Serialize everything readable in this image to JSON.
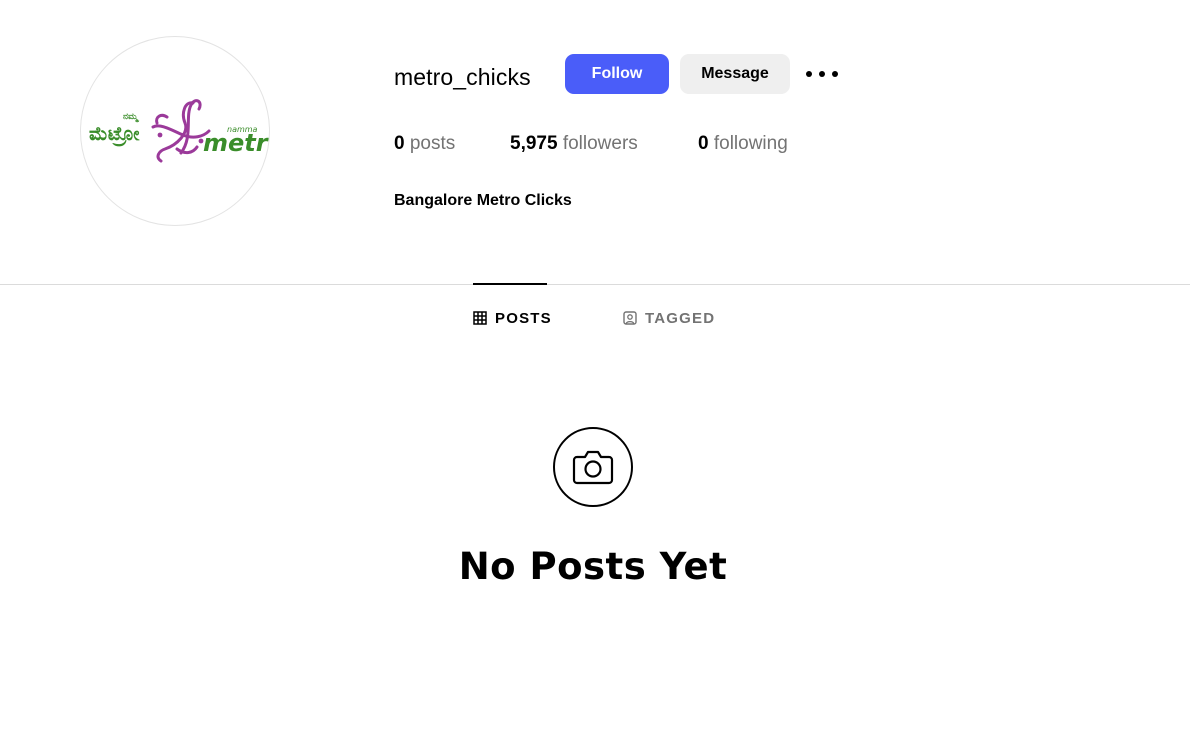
{
  "profile": {
    "username": "metro_chicks",
    "bio_name": "Bangalore Metro Clicks",
    "avatar_logo": {
      "kannada_small": "ನಮ್ಮ",
      "kannada_big": "ಮೆಟ್ರೋ",
      "english_small": "namma",
      "english_big": "metro",
      "green": "#3a8d2a",
      "purple": "#9b3a9a"
    }
  },
  "actions": {
    "follow_label": "Follow",
    "message_label": "Message",
    "more_icon": "more-horizontal-icon"
  },
  "stats": {
    "posts_count": "0",
    "posts_label": "posts",
    "followers_count": "5,975",
    "followers_label": "followers",
    "following_count": "0",
    "following_label": "following"
  },
  "tabs": [
    {
      "label": "POSTS",
      "icon": "grid-icon",
      "active": true
    },
    {
      "label": "TAGGED",
      "icon": "tagged-person-icon",
      "active": false
    }
  ],
  "empty_state": {
    "icon": "camera-icon",
    "title": "No Posts Yet"
  },
  "colors": {
    "accent": "#4a5df9",
    "secondary_button": "#efefef",
    "muted_text": "#737373",
    "divider": "#dbdbdb"
  }
}
